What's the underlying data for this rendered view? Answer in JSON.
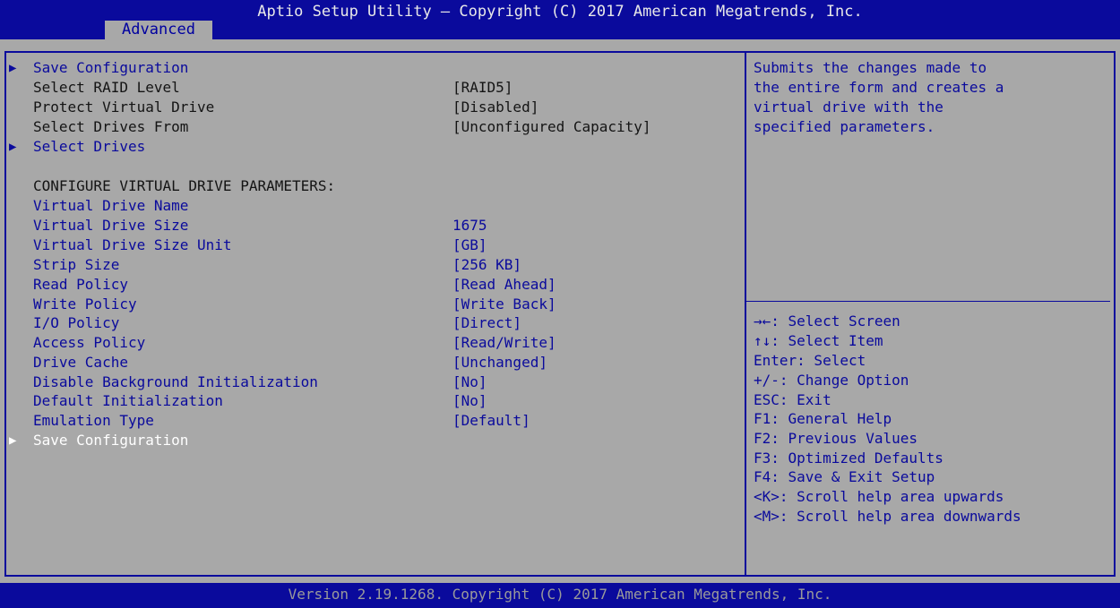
{
  "header": {
    "title": "Aptio Setup Utility – Copyright (C) 2017 American Megatrends, Inc.",
    "tab_label": "Advanced"
  },
  "menu": {
    "save_config_top": "Save Configuration",
    "raid_level_label": "Select RAID Level",
    "raid_level_value": "[RAID5]",
    "protect_label": "Protect Virtual Drive",
    "protect_value": "[Disabled]",
    "drives_from_label": "Select Drives From",
    "drives_from_value": "[Unconfigured Capacity]",
    "select_drives": "Select Drives",
    "section_heading": "CONFIGURE VIRTUAL DRIVE PARAMETERS:",
    "vd_name_label": "Virtual Drive Name",
    "vd_size_label": "Virtual Drive Size",
    "vd_size_value": "1675",
    "vd_unit_label": "Virtual Drive Size Unit",
    "vd_unit_value": "[GB]",
    "strip_label": "Strip Size",
    "strip_value": "[256 KB]",
    "read_label": "Read Policy",
    "read_value": "[Read Ahead]",
    "write_label": "Write Policy",
    "write_value": "[Write Back]",
    "io_label": "I/O Policy",
    "io_value": "[Direct]",
    "access_label": "Access Policy",
    "access_value": "[Read/Write]",
    "cache_label": "Drive Cache",
    "cache_value": "[Unchanged]",
    "dbi_label": "Disable Background Initialization",
    "dbi_value": "[No]",
    "default_init_label": "Default Initialization",
    "default_init_value": "[No]",
    "emulation_label": "Emulation Type",
    "emulation_value": "[Default]",
    "save_config_bottom": "Save Configuration"
  },
  "help": {
    "line1": "Submits the changes made to",
    "line2": "the entire form and creates a",
    "line3": "virtual drive with the",
    "line4": "specified parameters."
  },
  "keys": {
    "k1": "→←: Select Screen",
    "k2": "↑↓: Select Item",
    "k3": "Enter: Select",
    "k4": "+/-: Change Option",
    "k5": "ESC: Exit",
    "k6": "F1: General Help",
    "k7": "F2: Previous Values",
    "k8": "F3: Optimized Defaults",
    "k9": "F4: Save & Exit Setup",
    "k10": "<K>: Scroll help area upwards",
    "k11": "<M>: Scroll help area downwards"
  },
  "footer": {
    "version": "Version 2.19.1268. Copyright (C) 2017 American Megatrends, Inc."
  },
  "colors": {
    "frame_blue": "#0a0a9c",
    "panel_gray": "#a8a8a8",
    "selected_text": "#ffffff"
  }
}
